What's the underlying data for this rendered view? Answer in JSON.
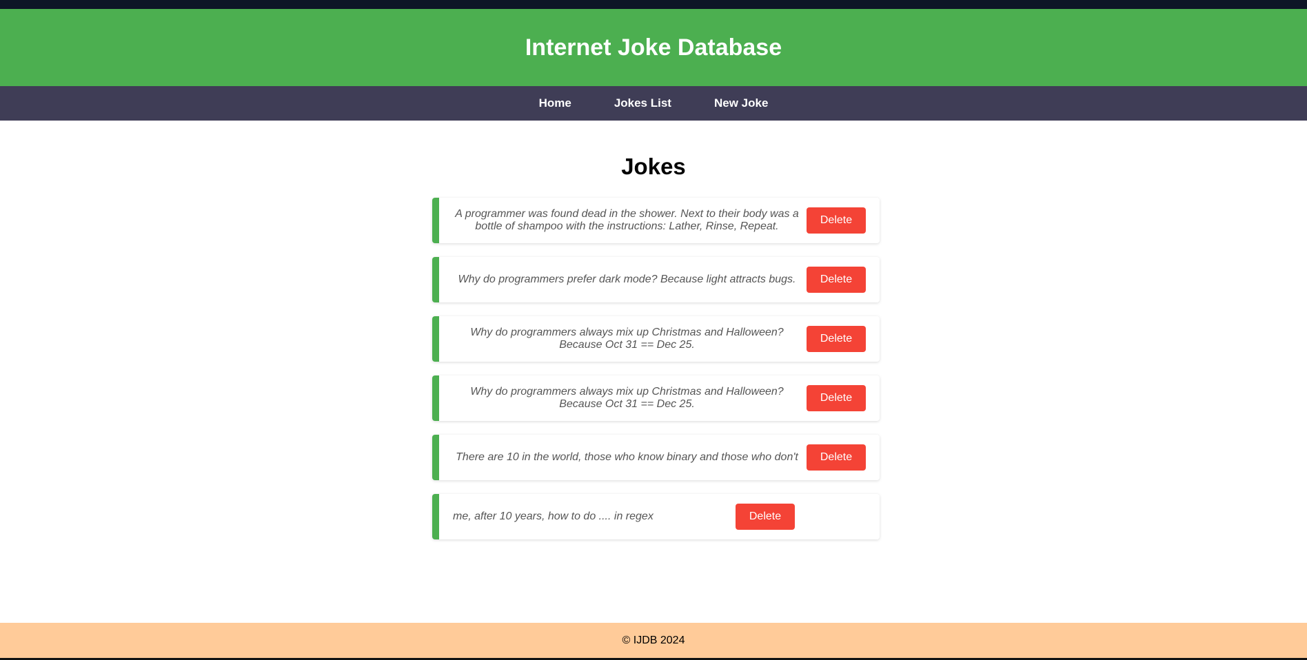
{
  "header": {
    "title": "Internet Joke Database"
  },
  "nav": {
    "items": [
      {
        "label": "Home"
      },
      {
        "label": "Jokes List"
      },
      {
        "label": "New Joke"
      }
    ]
  },
  "main": {
    "title": "Jokes",
    "jokes": [
      {
        "text": "A programmer was found dead in the shower. Next to their body was a bottle of shampoo with the instructions: Lather, Rinse, Repeat.",
        "delete_label": "Delete"
      },
      {
        "text": "Why do programmers prefer dark mode? Because light attracts bugs.",
        "delete_label": "Delete"
      },
      {
        "text": "Why do programmers always mix up Christmas and Halloween? Because Oct 31 == Dec 25.",
        "delete_label": "Delete"
      },
      {
        "text": "Why do programmers always mix up Christmas and Halloween? Because Oct 31 == Dec 25.",
        "delete_label": "Delete"
      },
      {
        "text": "There are 10 in the world, those who know binary and those who don't",
        "delete_label": "Delete"
      },
      {
        "text": "me, after 10 years, how to do .... in regex",
        "delete_label": "Delete"
      }
    ]
  },
  "footer": {
    "text": "© IJDB 2024"
  },
  "colors": {
    "header_bg": "#4caf50",
    "nav_bg": "#3f3d56",
    "delete_bg": "#f44336",
    "footer_bg": "#ffcb99",
    "card_accent": "#4caf50"
  }
}
